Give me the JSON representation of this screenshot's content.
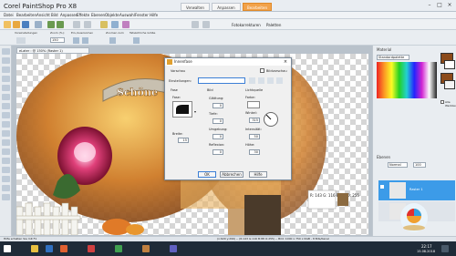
{
  "app": {
    "title": "Corel PaintShop Pro X8",
    "tabs": [
      "Verwalten",
      "Anpassen",
      "Bearbeiten"
    ],
    "active_tab": 2
  },
  "menu": [
    "Datei",
    "Bearbeiten",
    "Ansicht",
    "Bild",
    "Anpassen",
    "Effekte",
    "Ebenen",
    "Objekte",
    "Auswahl",
    "Fenster",
    "Hilfe"
  ],
  "tooloptions": {
    "labels": [
      "Voreinstellungen",
      "Zoom (%):",
      "Ein-/Auszoomen",
      "Zoomen zum",
      "Tatsächliche Größe"
    ],
    "zoom_value": "150",
    "palettes_label": "Fotokorrekturen",
    "paletten": "Paletten"
  },
  "document": {
    "tab": "eLater : @ 150% (Raster 1)",
    "banner_text": "Schöne"
  },
  "dialog": {
    "title": "Innenfase",
    "preview_label": "Vorschau",
    "image_preview_label": "Bildvorschau",
    "settings_label": "Einstellungen:",
    "sections": {
      "face": "Fase",
      "image": "Bild",
      "light": "Lichtquelle"
    },
    "face_label": "Fase:",
    "width_label": "Breite:",
    "width_value": "15",
    "smooth_label": "Glättung:",
    "smooth_value": "0",
    "depth_label": "Tiefe:",
    "depth_value": "0",
    "ambient_label": "Umgebung:",
    "ambient_value": "0",
    "reflect_label": "Reflexion:",
    "reflect_value": "0",
    "color_label": "Farbe:",
    "angle_label": "Winkel:",
    "angle_value": "315",
    "intensity_label": "Intensität:",
    "intensity_value": "50",
    "elevation_label": "Höhe:",
    "elevation_value": "30",
    "buttons": {
      "ok": "OK",
      "cancel": "Abbrechen",
      "help": "Hilfe"
    }
  },
  "right": {
    "material_title": "Material",
    "standard_palette": "Standardpalette",
    "all_tools": "Alle Werkzeuge",
    "layers_title": "Ebenen",
    "blend_mode": "Normal",
    "opacity": "100",
    "layer_name": "Raster 1",
    "color_readout": "R: 143 G: 116 B: 88 O: 255"
  },
  "status": {
    "left": "Hilfe erhalten Sie mit F1",
    "right": "(x:629 y:299) -- (R:143 G:116 B:88 O:255) -- Bild: 1000 x 750 x RGB - 8 Bits/Kanal"
  },
  "taskbar": {
    "time": "22:17",
    "date": "15.08.2018"
  },
  "colors": {
    "accent": "#f2a24a",
    "foreground": "#8b4a1a",
    "background": "#ffffff",
    "layer_sel": "#3c9be8"
  }
}
